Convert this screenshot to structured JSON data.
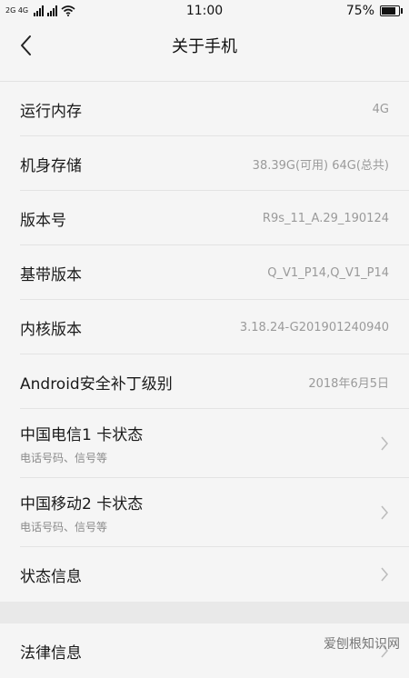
{
  "status": {
    "network_label": "2G 4G",
    "time": "11:00",
    "battery_text": "75%",
    "battery_level": 0.75
  },
  "header": {
    "title": "关于手机"
  },
  "items": [
    {
      "label": "运行内存",
      "value": "4G"
    },
    {
      "label": "机身存储",
      "value": "38.39G(可用)  64G(总共)"
    },
    {
      "label": "版本号",
      "value": "R9s_11_A.29_190124"
    },
    {
      "label": "基带版本",
      "value": "Q_V1_P14,Q_V1_P14"
    },
    {
      "label": "内核版本",
      "value": "3.18.24-G201901240940"
    },
    {
      "label": "Android安全补丁级别",
      "value": "2018年6月5日"
    },
    {
      "label": "中国电信1 卡状态",
      "sub": "电话号码、信号等"
    },
    {
      "label": "中国移动2 卡状态",
      "sub": "电话号码、信号等"
    },
    {
      "label": "状态信息"
    },
    {
      "label": "法律信息"
    }
  ],
  "watermark": "爱刨根知识网"
}
